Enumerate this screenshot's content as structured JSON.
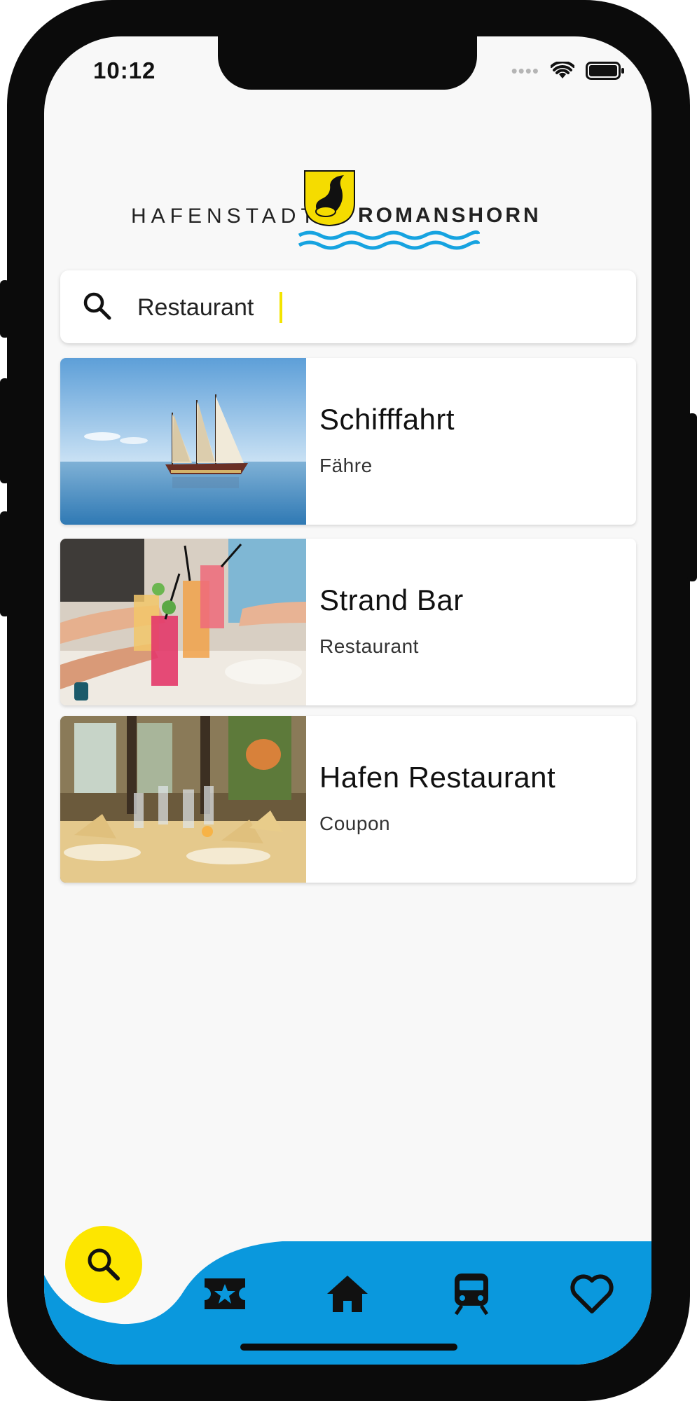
{
  "status_bar": {
    "time": "10:12"
  },
  "logo": {
    "left_text": "HAFENSTADT",
    "right_text": "ROMANSHORN"
  },
  "search": {
    "value": "Restaurant",
    "icon": "search-icon"
  },
  "results": [
    {
      "title": "Schifffahrt",
      "subtitle": "Fähre",
      "image": "sailing-ship"
    },
    {
      "title": "Strand Bar",
      "subtitle": "Restaurant",
      "image": "cocktail-toast"
    },
    {
      "title": "Hafen Restaurant",
      "subtitle": "Coupon",
      "image": "restaurant-tables"
    }
  ],
  "bottom_nav": {
    "active": "search",
    "items": [
      "search-icon",
      "ticket-star-icon",
      "home-icon",
      "train-icon",
      "heart-icon"
    ]
  },
  "colors": {
    "brand_blue": "#0a98dd",
    "accent_yellow": "#fde600",
    "logo_wave": "#16a3e0"
  }
}
